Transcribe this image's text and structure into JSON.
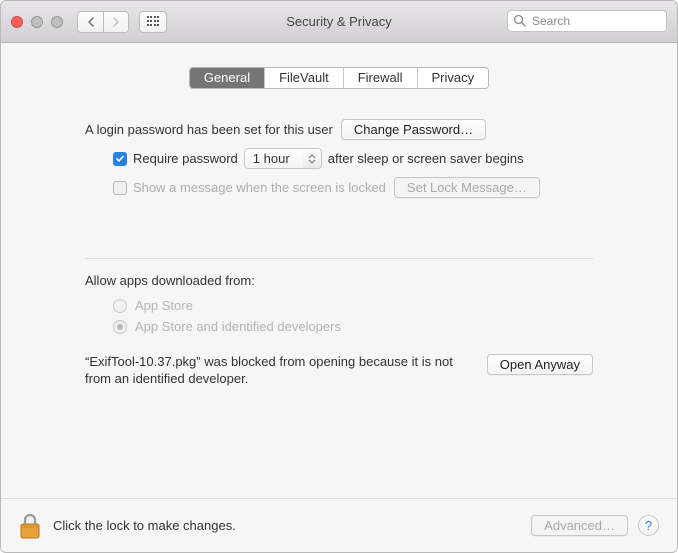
{
  "window": {
    "title": "Security & Privacy"
  },
  "search": {
    "placeholder": "Search"
  },
  "tabs": [
    {
      "label": "General",
      "active": true
    },
    {
      "label": "FileVault",
      "active": false
    },
    {
      "label": "Firewall",
      "active": false
    },
    {
      "label": "Privacy",
      "active": false
    }
  ],
  "login": {
    "text": "A login password has been set for this user",
    "change_btn": "Change Password…",
    "require_label": "Require password",
    "require_checked": true,
    "delay_selected": "1 hour",
    "after_text": "after sleep or screen saver begins",
    "show_msg_label": "Show a message when the screen is locked",
    "show_msg_checked": false,
    "set_msg_btn": "Set Lock Message…"
  },
  "download": {
    "heading": "Allow apps downloaded from:",
    "opt1": "App Store",
    "opt2": "App Store and identified developers",
    "selected": "opt2"
  },
  "blocked": {
    "text": "“ExifTool-10.37.pkg” was blocked from opening because it is not from an identified developer.",
    "open_btn": "Open Anyway"
  },
  "footer": {
    "lock_text": "Click the lock to make changes.",
    "advanced_btn": "Advanced…",
    "help": "?"
  }
}
